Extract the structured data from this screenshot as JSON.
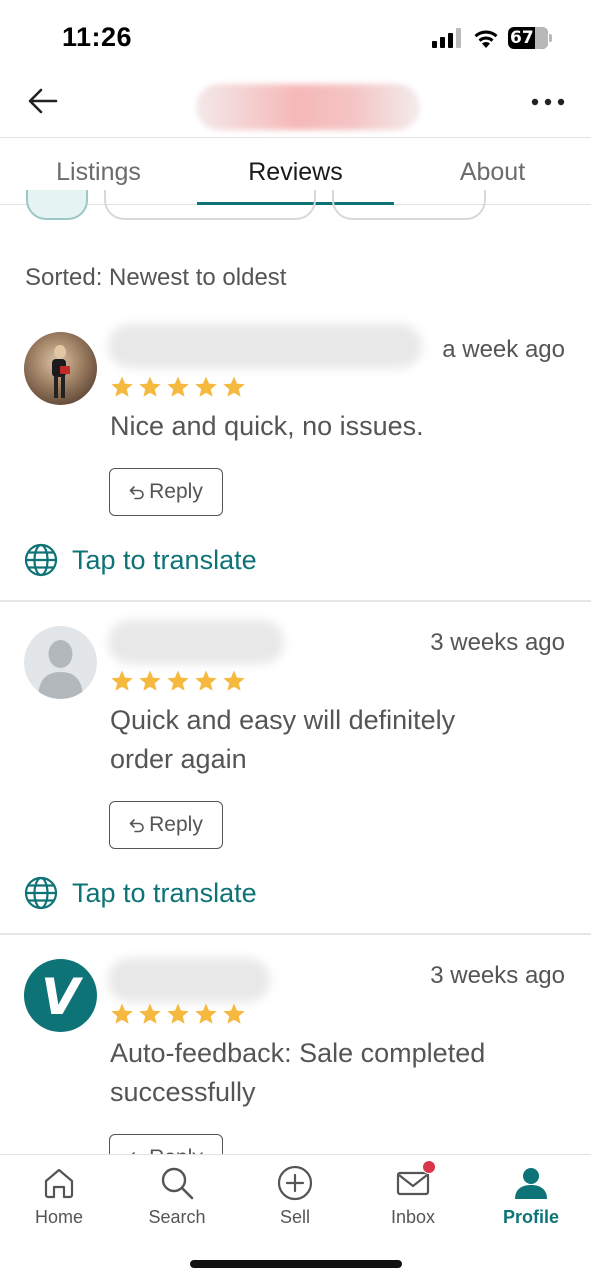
{
  "status_bar": {
    "time": "11:26",
    "battery": "67"
  },
  "header": {
    "back_icon": "arrow-left-icon",
    "more_icon": "more-horizontal-icon"
  },
  "tabs": [
    {
      "label": "Listings"
    },
    {
      "label": "Reviews"
    },
    {
      "label": "About"
    }
  ],
  "sorted_label": "Sorted: Newest to oldest",
  "reviews": [
    {
      "date": "a week ago",
      "rating": 5,
      "text": "Nice and quick, no issues.",
      "reply_label": "Reply",
      "translate_label": "Tap to translate"
    },
    {
      "date": "3 weeks ago",
      "rating": 5,
      "text": "Quick and easy will definitely order again",
      "reply_label": "Reply",
      "translate_label": "Tap to translate"
    },
    {
      "date": "3 weeks ago",
      "rating": 5,
      "text": "Auto-feedback: Sale completed successfully",
      "reply_label": "Reply",
      "avatar_letter": "V"
    }
  ],
  "bottom_nav": [
    {
      "label": "Home",
      "icon": "home-icon"
    },
    {
      "label": "Search",
      "icon": "search-icon"
    },
    {
      "label": "Sell",
      "icon": "plus-circle-icon"
    },
    {
      "label": "Inbox",
      "icon": "mail-icon"
    },
    {
      "label": "Profile",
      "icon": "person-icon"
    }
  ],
  "colors": {
    "accent": "#0e7377",
    "star": "#f5b93f",
    "badge": "#d9364a"
  }
}
